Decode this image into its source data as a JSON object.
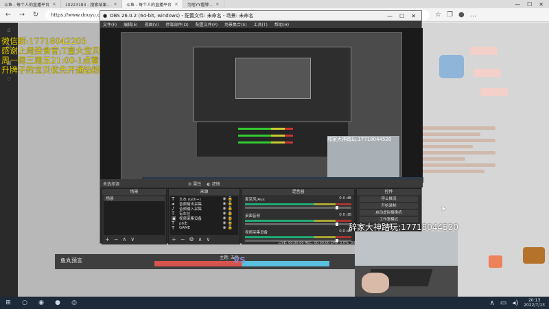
{
  "browser": {
    "tabs": [
      {
        "label": "斗鱼 - 每个人的直播平台",
        "active": false
      },
      {
        "label": "10223183 - 搜索结果...",
        "active": false
      },
      {
        "label": "斗鱼 - 每个人的直播平台",
        "active": true
      },
      {
        "label": "为啥YY看牌...",
        "active": false
      }
    ],
    "url": "https://www.douyu.com/102..."
  },
  "overlay": {
    "lines": [
      "微信群:17718042205",
      "感谢上周投食官;T皇大宝贝",
      "周一周三周五21:00-1点看水友可以到",
      "升牌子的宝贝优先开通钻粉哟~"
    ]
  },
  "obs": {
    "title": "OBS 26.0.2 (64-bit, windows) - 配置文件: 未命名 - 场景: 未命名",
    "menu": [
      "文件(F)",
      "编辑(E)",
      "视图(V)",
      "停靠部件(D)",
      "配置文件(P)",
      "场景集合(S)",
      "工具(T)",
      "帮助(H)"
    ],
    "no_source": "未选择源",
    "properties": "属性",
    "filters": "滤镜",
    "docks": {
      "scenes": {
        "title": "场景",
        "items": [
          "场景"
        ]
      },
      "sources": {
        "title": "来源",
        "items": [
          "文本 (GDI+)",
          "音频输出采集",
          "音频输入采集",
          "有车位",
          "视频采集设备",
          "p6击",
          "GAME"
        ]
      },
      "mixer": {
        "title": "混音器",
        "channels": [
          {
            "name": "麦克风/Aux",
            "db": "0.0 dB"
          },
          {
            "name": "桌面音频",
            "db": "0.0 dB"
          },
          {
            "name": "视频采集设备",
            "db": "0.0 dB"
          }
        ]
      },
      "controls": {
        "title": "控件",
        "buttons": [
          "停止推流",
          "开始录制",
          "启动虚拟摄像机",
          "工作室模式",
          "设置",
          "退出"
        ]
      }
    },
    "status": "LIVE: 00:00:00   REC: 00:00:00   CPU: 3.0%, 30.00 fps"
  },
  "webcam_label": "辞家大神踏玩;17718044520",
  "bottom": {
    "yuwan": "鱼丸预言",
    "zhuti": "主题: 五杀",
    "vs": "VS"
  },
  "taskbar": {
    "time": "20:13",
    "date": "2022/7/13"
  }
}
